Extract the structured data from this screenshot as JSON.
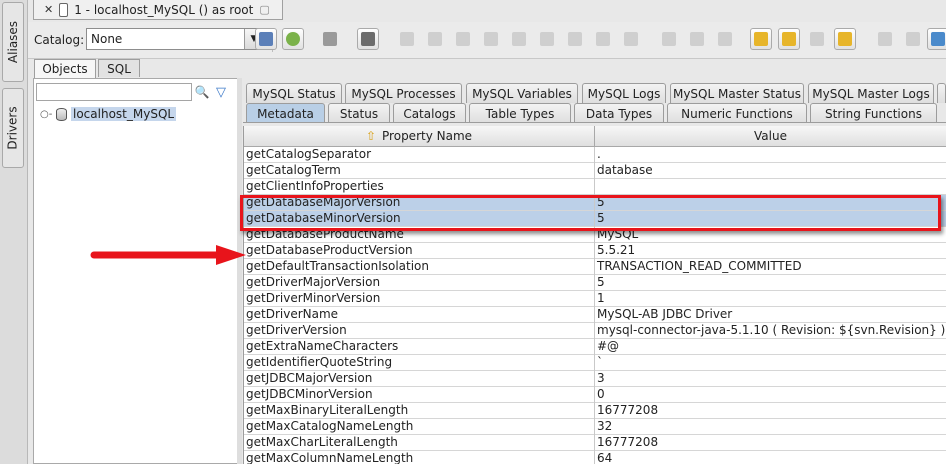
{
  "side_tabs": [
    "Aliases",
    "Drivers"
  ],
  "doc_tab": {
    "close": "✕",
    "title": "1 - localhost_MySQL () as root"
  },
  "toolbar": {
    "catalog_label": "Catalog:",
    "catalog_value": "None"
  },
  "sub_tabs": [
    "Objects",
    "SQL"
  ],
  "tree": {
    "node_label": "localhost_MySQL",
    "search_placeholder": ""
  },
  "tabs_row1": [
    "MySQL Status",
    "MySQL Processes",
    "MySQL Variables",
    "MySQL Logs",
    "MySQL Master Status",
    "MySQL Master Logs"
  ],
  "tabs_row2": [
    "Metadata",
    "Status",
    "Catalogs",
    "Table Types",
    "Data Types",
    "Numeric Functions",
    "String Functions"
  ],
  "grid": {
    "headers": [
      "Property Name",
      "Value"
    ],
    "rows": [
      [
        "getCatalogSeparator",
        "."
      ],
      [
        "getCatalogTerm",
        "database"
      ],
      [
        "getClientInfoProperties",
        ""
      ],
      [
        "getDatabaseMajorVersion",
        "5"
      ],
      [
        "getDatabaseMinorVersion",
        "5"
      ],
      [
        "getDatabaseProductName",
        "MySQL"
      ],
      [
        "getDatabaseProductVersion",
        "5.5.21"
      ],
      [
        "getDefaultTransactionIsolation",
        "TRANSACTION_READ_COMMITTED"
      ],
      [
        "getDriverMajorVersion",
        "5"
      ],
      [
        "getDriverMinorVersion",
        "1"
      ],
      [
        "getDriverName",
        "MySQL-AB JDBC Driver"
      ],
      [
        "getDriverVersion",
        "mysql-connector-java-5.1.10 ( Revision: ${svn.Revision} )"
      ],
      [
        "getExtraNameCharacters",
        "#@"
      ],
      [
        "getIdentifierQuoteString",
        "`"
      ],
      [
        "getJDBCMajorVersion",
        "3"
      ],
      [
        "getJDBCMinorVersion",
        "0"
      ],
      [
        "getMaxBinaryLiteralLength",
        "16777208"
      ],
      [
        "getMaxCatalogNameLength",
        "32"
      ],
      [
        "getMaxCharLiteralLength",
        "16777208"
      ],
      [
        "getMaxColumnNameLength",
        "64"
      ]
    ],
    "highlighted_rows": [
      3,
      4
    ]
  },
  "colors": {
    "highlight": "#bcd0e8",
    "annotation": "#e8141b",
    "selected_tab": "#b9cfe6"
  }
}
